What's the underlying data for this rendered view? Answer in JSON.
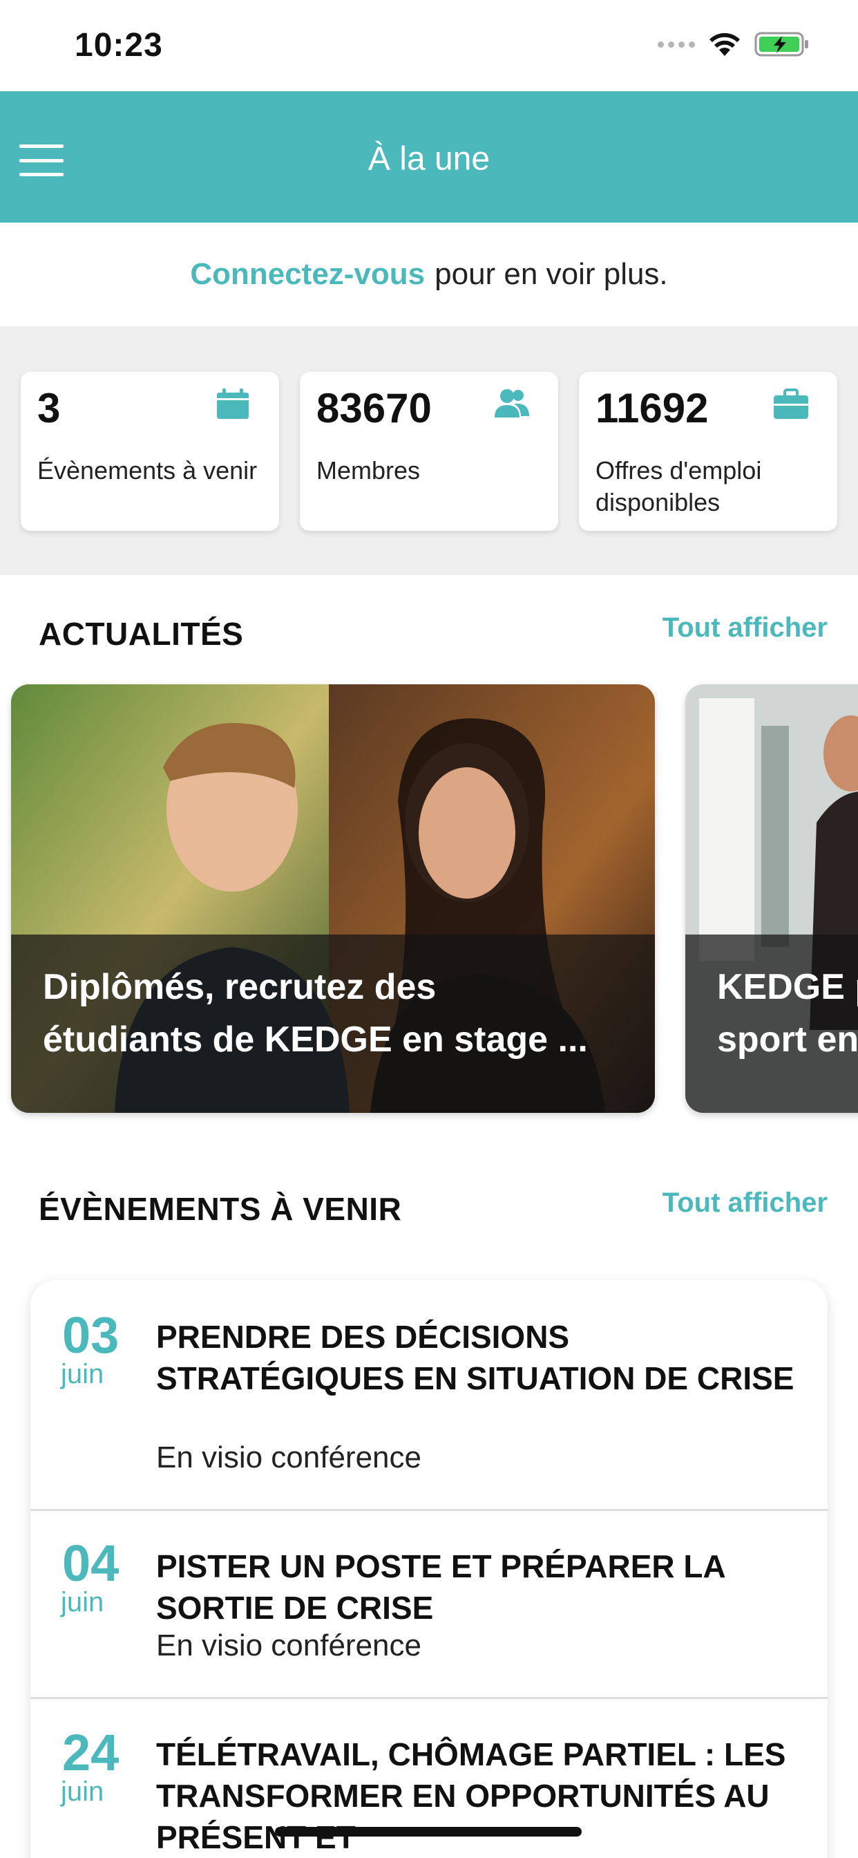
{
  "status_bar": {
    "time": "10:23",
    "icons": [
      "signal-dots",
      "wifi-icon",
      "battery-charging-icon"
    ]
  },
  "header": {
    "title": "À la une",
    "menu_icon": "hamburger-menu-icon"
  },
  "login_prompt": {
    "link": "Connectez-vous",
    "text": "pour en voir plus."
  },
  "stats": [
    {
      "value": "3",
      "label": "Évènements à venir",
      "icon": "calendar-icon"
    },
    {
      "value": "83670",
      "label": "Membres",
      "icon": "users-icon"
    },
    {
      "value": "11692",
      "label": "Offres d'emploi disponibles",
      "icon": "briefcase-icon"
    }
  ],
  "news": {
    "title": "ACTUALITÉS",
    "see_all": "Tout afficher",
    "items": [
      {
        "title": "Diplômés, recrutez des",
        "title_line2": "étudiants de KEDGE en stage ..."
      },
      {
        "title": "KEDGE p",
        "title_line2": "sport en"
      }
    ]
  },
  "events": {
    "title": "ÉVÈNEMENTS À VENIR",
    "see_all": "Tout afficher",
    "items": [
      {
        "day": "03",
        "month": "juin",
        "title": "PRENDRE DES DÉCISIONS STRATÉGIQUES EN SITUATION DE CRISE",
        "location": "En visio conférence"
      },
      {
        "day": "04",
        "month": "juin",
        "title": "PISTER UN POSTE ET PRÉPARER LA SORTIE DE CRISE",
        "location": "En visio conférence"
      },
      {
        "day": "24",
        "month": "juin",
        "title": "TÉLÉTRAVAIL, CHÔMAGE PARTIEL : LES TRANSFORMER EN OPPORTUNITÉS AU PRÉSENT ET",
        "location": ""
      }
    ]
  },
  "colors": {
    "accent": "#4bb8bc",
    "background_grey": "#efefef",
    "text": "#111111"
  }
}
